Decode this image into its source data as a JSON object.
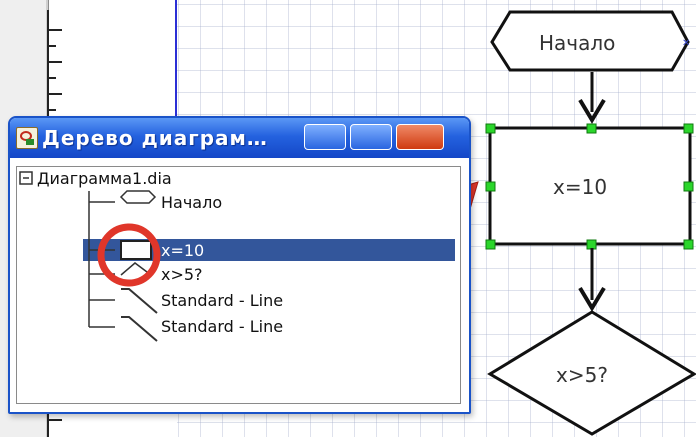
{
  "canvas": {
    "nodes": {
      "start_label": "Начало",
      "process_label": "x=10",
      "decision_label": "x>5?"
    }
  },
  "tree_window": {
    "title": "Дерево диаграм…",
    "root_label": "Диаграмма1.dia",
    "items": [
      {
        "label": "Начало",
        "selected": false
      },
      {
        "label": "x=10",
        "selected": true
      },
      {
        "label": "x>5?",
        "selected": false
      },
      {
        "label": "Standard - Line",
        "selected": false
      },
      {
        "label": "Standard - Line",
        "selected": false
      }
    ]
  },
  "colors": {
    "title_bar": "#2462df",
    "selection": "#33569b",
    "handle": "#2bd62b",
    "highlight_red": "#e0362a"
  }
}
